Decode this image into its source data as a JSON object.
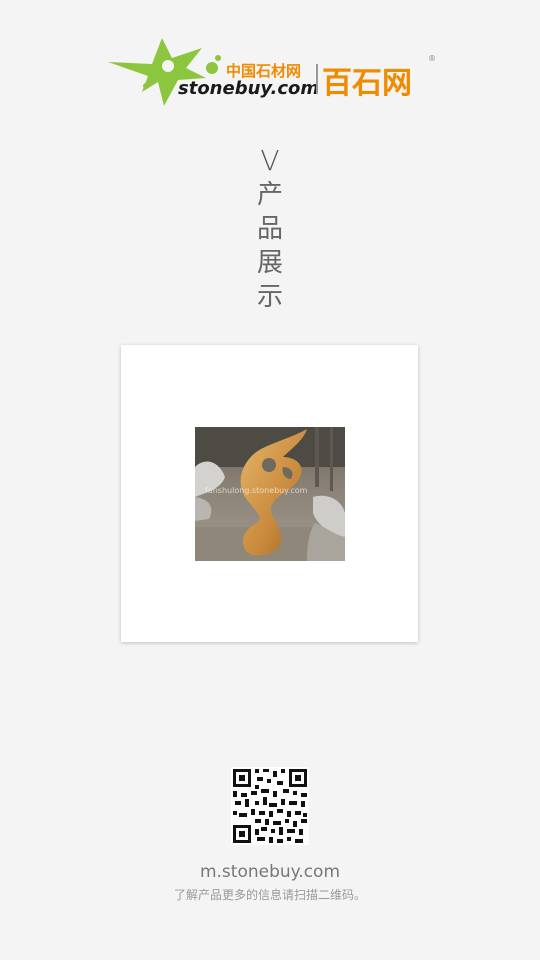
{
  "brand": {
    "cn_small": "中国石材网",
    "latin": "stonebuy.com",
    "cn_big": "百石网",
    "reg": "®",
    "colors": {
      "green": "#8cc63f",
      "orange": "#f08a00"
    }
  },
  "section": {
    "marker": "V",
    "title": "产品展示"
  },
  "product": {
    "image_watermark": "fanshulong.stonebuy.com"
  },
  "footer": {
    "site": "m.stonebuy.com",
    "tip": "了解产品更多的信息请扫描二维码。"
  }
}
